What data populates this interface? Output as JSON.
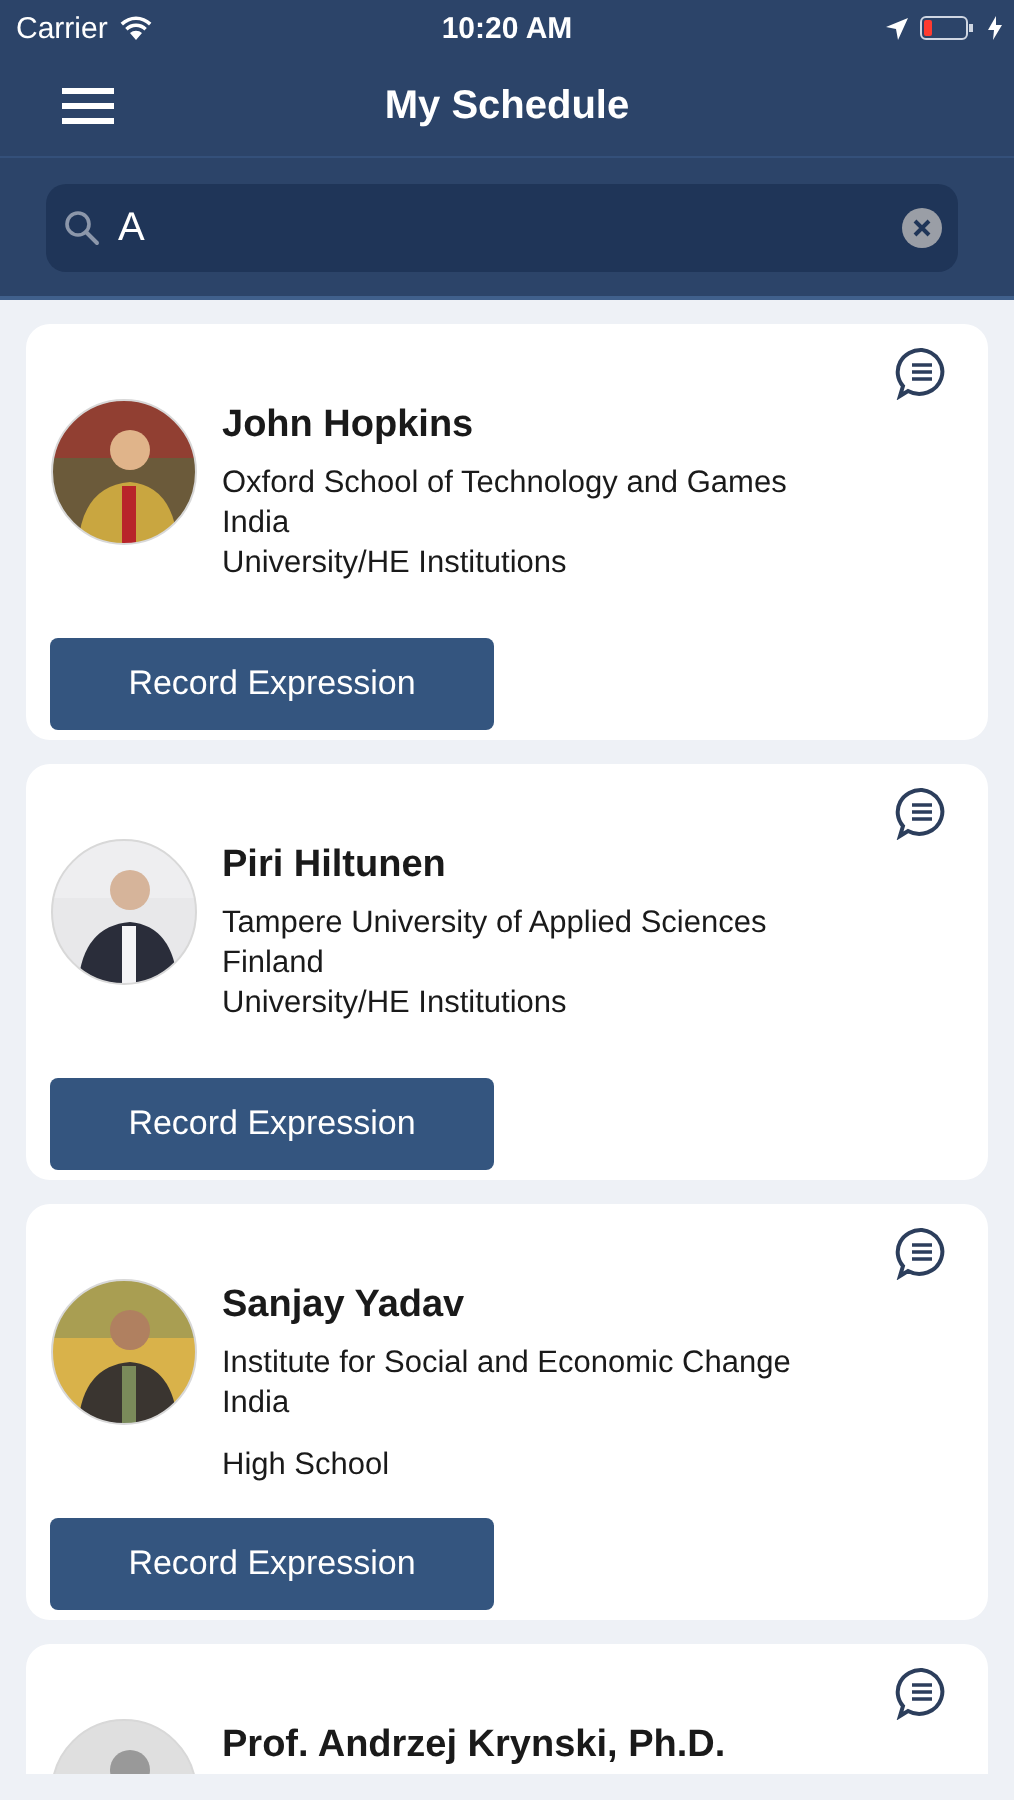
{
  "status_bar": {
    "carrier": "Carrier",
    "time": "10:20 AM",
    "battery_low": true
  },
  "nav": {
    "title": "My Schedule"
  },
  "search": {
    "value": "A"
  },
  "people": [
    {
      "name": "John Hopkins",
      "lines": [
        {
          "text": "Oxford School of Technology and Games",
          "spaced": false
        },
        {
          "text": "India",
          "spaced": false
        },
        {
          "text": "University/HE Institutions",
          "spaced": false
        }
      ],
      "button": "Record Expression"
    },
    {
      "name": "Piri Hiltunen",
      "lines": [
        {
          "text": "Tampere University of Applied Sciences",
          "spaced": false
        },
        {
          "text": "Finland",
          "spaced": false
        },
        {
          "text": "University/HE Institutions",
          "spaced": false
        }
      ],
      "button": "Record Expression"
    },
    {
      "name": "Sanjay Yadav",
      "lines": [
        {
          "text": "Institute for Social and Economic Change",
          "spaced": false
        },
        {
          "text": "India",
          "spaced": false
        },
        {
          "text": "High School",
          "spaced": true
        }
      ],
      "button": "Record Expression"
    },
    {
      "name": "Prof. Andrzej Krynski, Ph.D."
    }
  ]
}
